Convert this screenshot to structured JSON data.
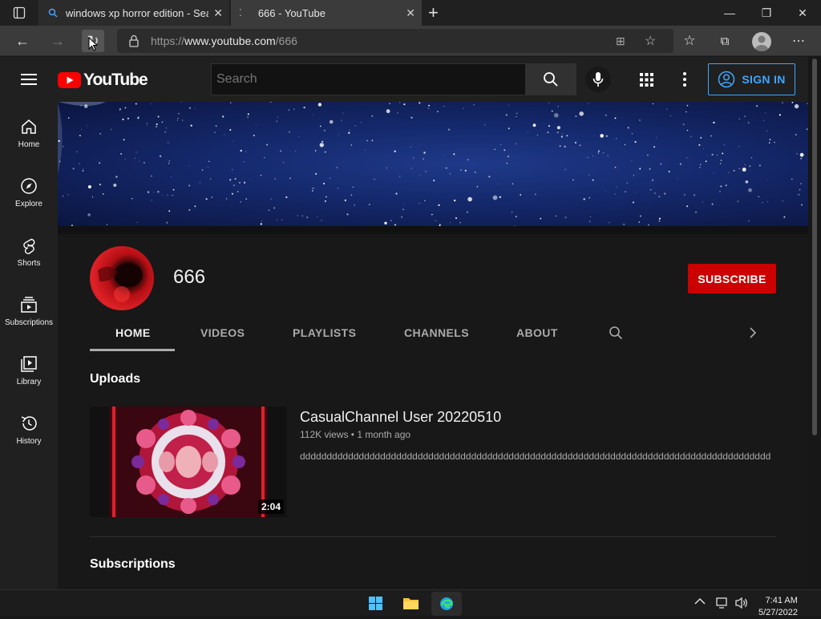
{
  "browser": {
    "tabs": [
      {
        "title": "windows xp horror edition - Sear",
        "icon": "search-icon"
      },
      {
        "title": "666 - YouTube",
        "icon": "loading-icon"
      }
    ],
    "new_tab_label": "+",
    "url_prefix": "https://",
    "url_host": "www.youtube.com",
    "url_path": "/666"
  },
  "youtube": {
    "logo_text": "YouTube",
    "search_placeholder": "Search",
    "sign_in_label": "SIGN IN",
    "sidebar": [
      {
        "label": "Home",
        "icon": "home-icon"
      },
      {
        "label": "Explore",
        "icon": "compass-icon"
      },
      {
        "label": "Shorts",
        "icon": "shorts-icon"
      },
      {
        "label": "Subscriptions",
        "icon": "subscriptions-icon"
      },
      {
        "label": "Library",
        "icon": "library-icon"
      },
      {
        "label": "History",
        "icon": "history-icon"
      }
    ],
    "channel": {
      "name": "666",
      "subscribe_label": "SUBSCRIBE",
      "tabs": [
        "HOME",
        "VIDEOS",
        "PLAYLISTS",
        "CHANNELS",
        "ABOUT"
      ],
      "active_tab": "HOME"
    },
    "uploads": {
      "section_title": "Uploads",
      "video": {
        "title": "CasualChannel User 20220510",
        "meta": "112K views • 1 month ago",
        "description": "dddddddddddddddddddddddddddddddddddddddddddddddddddddddddddddddddddddddddddddddddddddddd",
        "duration": "2:04"
      }
    },
    "subscriptions_title": "Subscriptions"
  },
  "taskbar": {
    "time": "7:41 AM",
    "date": "5/27/2022",
    "icons": [
      "windows-start-icon",
      "file-explorer-icon",
      "edge-icon"
    ]
  },
  "colors": {
    "accent_blue": "#3ea6ff",
    "subscribe_red": "#cc0000",
    "youtube_red": "#ff0000",
    "background": "#181818"
  }
}
